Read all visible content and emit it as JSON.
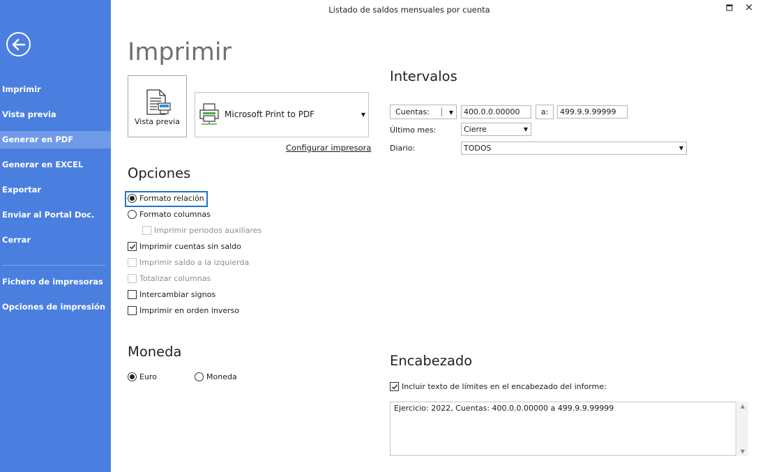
{
  "window": {
    "title": "Listado de saldos mensuales por cuenta",
    "close_glyph": "×"
  },
  "sidebar": {
    "background": "#4a7fe0",
    "active_background": "#6f9ae8",
    "back_icon": "arrow-left-icon",
    "items": [
      {
        "label": "Imprimir",
        "active": false
      },
      {
        "label": "Vista previa",
        "active": false
      },
      {
        "label": "Generar en PDF",
        "active": true
      },
      {
        "label": "Generar en EXCEL",
        "active": false
      },
      {
        "label": "Exportar",
        "active": false
      },
      {
        "label": "Enviar al Portal Doc.",
        "active": false
      },
      {
        "label": "Cerrar",
        "active": false
      }
    ],
    "secondary_items": [
      {
        "label": "Fichero de impresoras"
      },
      {
        "label": "Opciones de impresión"
      }
    ]
  },
  "main": {
    "heading": "Imprimir",
    "preview_button": {
      "label": "Vista previa",
      "icon": "document-preview-icon"
    },
    "printer": {
      "selected": "Microsoft Print to PDF",
      "icon": "printer-icon"
    },
    "configure_link": "Configurar impresora"
  },
  "opciones": {
    "title": "Opciones",
    "items": [
      {
        "label": "Formato relación",
        "type": "radio",
        "checked": true,
        "enabled": true
      },
      {
        "label": "Formato columnas",
        "type": "radio",
        "checked": false,
        "enabled": true
      },
      {
        "label": "Imprimir periodos auxiliares",
        "type": "checkbox",
        "checked": false,
        "enabled": false
      },
      {
        "label": "Imprimir cuentas sin saldo",
        "type": "checkbox",
        "checked": true,
        "enabled": true
      },
      {
        "label": "Imprimir saldo a la izquierda",
        "type": "checkbox",
        "checked": false,
        "enabled": false
      },
      {
        "label": "Totalizar columnas",
        "type": "checkbox",
        "checked": false,
        "enabled": false
      },
      {
        "label": "Intercambiar signos",
        "type": "checkbox",
        "checked": false,
        "enabled": true
      },
      {
        "label": "Imprimir en orden inverso",
        "type": "checkbox",
        "checked": false,
        "enabled": true
      }
    ]
  },
  "moneda": {
    "title": "Moneda",
    "options": [
      {
        "label": "Euro",
        "checked": true
      },
      {
        "label": "Moneda",
        "checked": false
      }
    ]
  },
  "intervalos": {
    "title": "Intervalos",
    "type_selector": "Cuentas:",
    "from_value": "400.0.0.00000",
    "to_label": "a:",
    "to_value": "499.9.9.99999",
    "ultimo_mes_label": "Último mes:",
    "ultimo_mes_value": "Cierre",
    "diario_label": "Diario:",
    "diario_value": "TODOS"
  },
  "encabezado": {
    "title": "Encabezado",
    "checkbox_label": "Incluir texto de límites en el encabezado del informe:",
    "checkbox_checked": true,
    "text": "Ejercicio: 2022, Cuentas: 400.0.0.00000 a 499.9.9.99999"
  }
}
